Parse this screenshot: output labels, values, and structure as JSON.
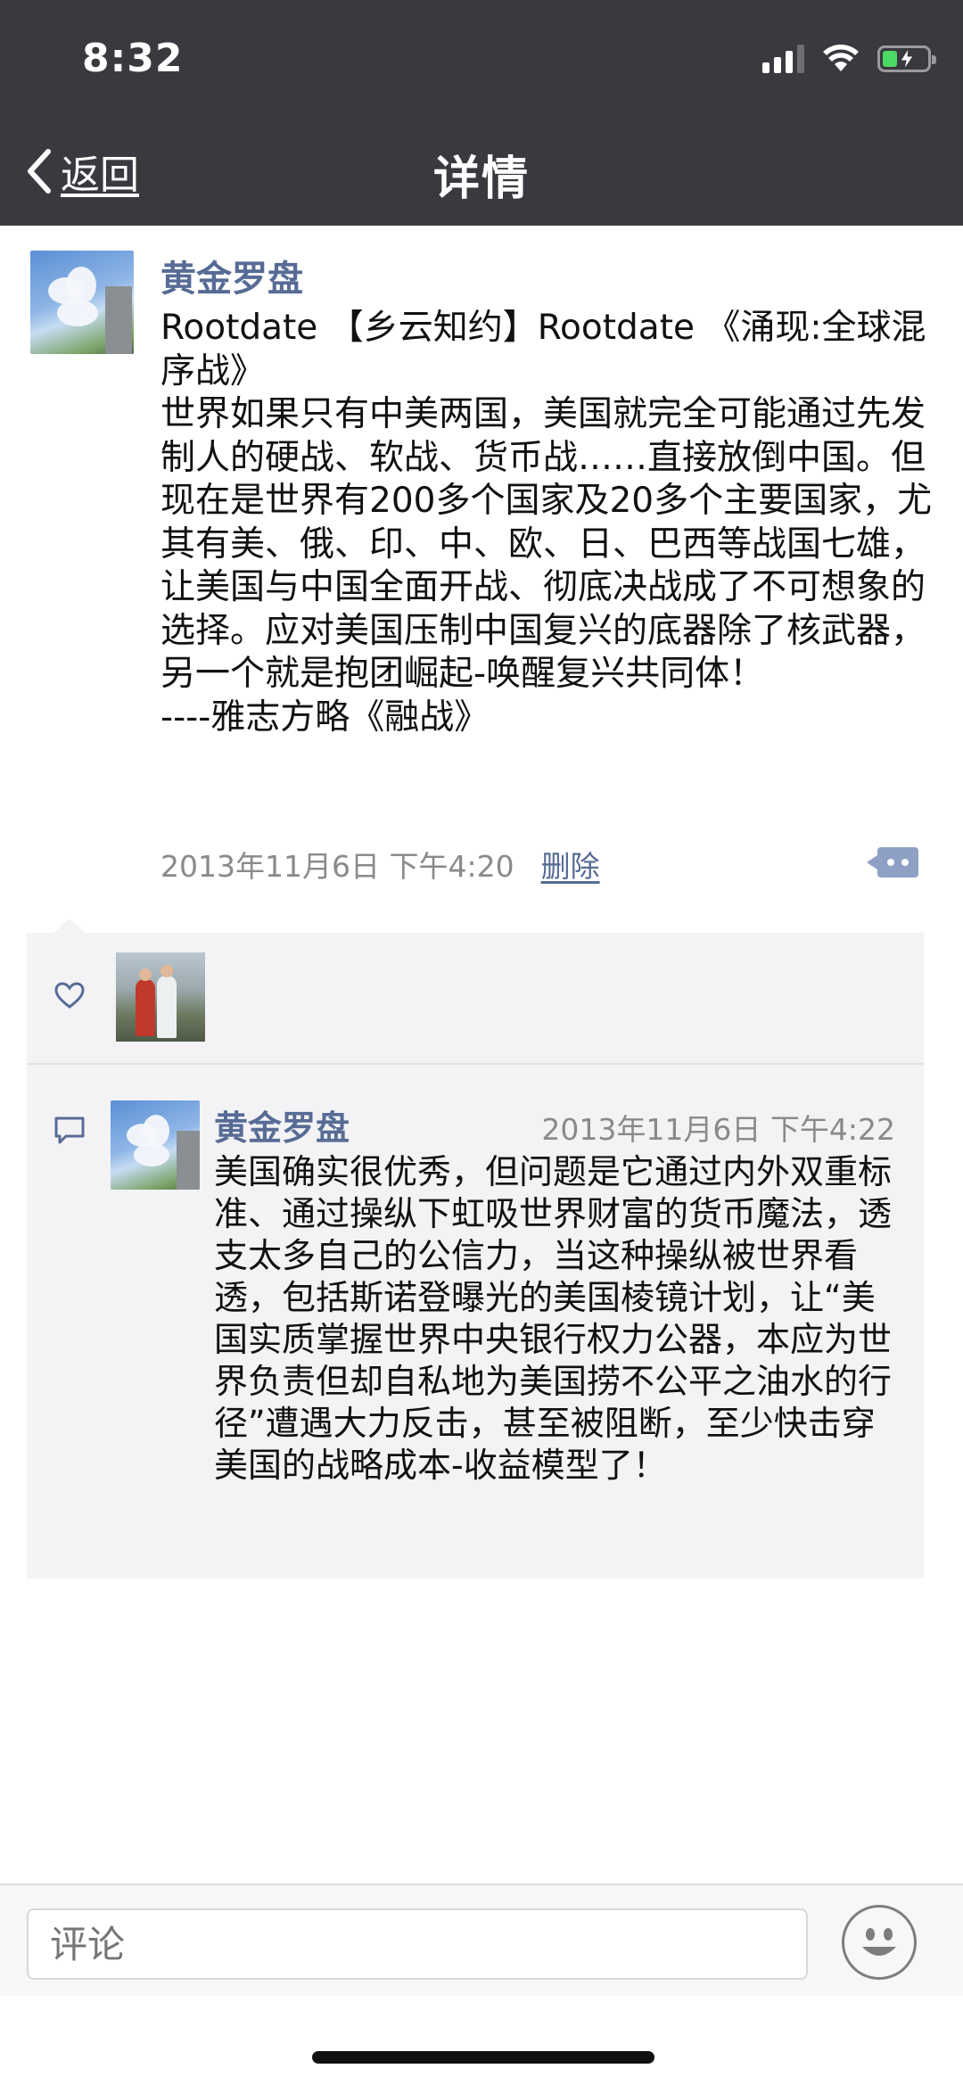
{
  "status_bar": {
    "time": "8:32"
  },
  "nav": {
    "back_label": "返回",
    "title": "详情"
  },
  "post": {
    "author": "黄金罗盘",
    "text": "Rootdate 【乡云知约】Rootdate 《涌现:全球混序战》\n世界如果只有中美两国，美国就完全可能通过先发制人的硬战、软战、货币战……直接放倒中国。但现在是世界有200多个国家及20多个主要国家，尤其有美、俄、印、中、欧、日、巴西等战国七雄，让美国与中国全面开战、彻底决战成了不可想象的选择。应对美国压制中国复兴的底器除了核武器，另一个就是抱团崛起-唤醒复兴共同体！\n----雅志方略《融战》",
    "timestamp": "2013年11月6日 下午4:20",
    "delete_label": "删除"
  },
  "comment": {
    "author": "黄金罗盘",
    "timestamp": "2013年11月6日 下午4:22",
    "text": "美国确实很优秀，但问题是它通过内外双重标准、通过操纵下虹吸世界财富的货币魔法，透支太多自己的公信力，当这种操纵被世界看透，包括斯诺登曝光的美国棱镜计划，让“美国实质掌握世界中央银行权力公器，本应为世界负责但却自私地为美国捞不公平之油水的行径”遭遇大力反击，甚至被阻断，至少快击穿美国的战略成本-收益模型了！"
  },
  "input": {
    "placeholder": "评论"
  },
  "colors": {
    "header_bg": "#393a3f",
    "link": "#576b95",
    "panel_bg": "#f3f3f5"
  }
}
